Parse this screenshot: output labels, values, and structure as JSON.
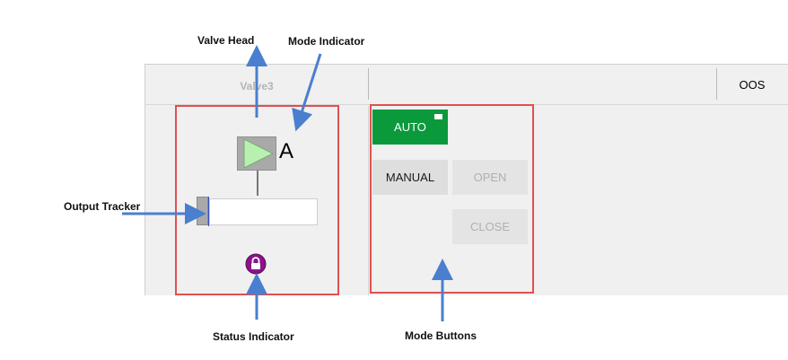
{
  "panel": {
    "title": "Valve3",
    "oos_label": "OOS"
  },
  "valve": {
    "mode_letter": "A"
  },
  "buttons": {
    "auto": "AUTO",
    "manual": "MANUAL",
    "open": "OPEN",
    "close": "CLOSE"
  },
  "annotations": {
    "valve_head": "Valve Head",
    "mode_indicator": "Mode Indicator",
    "output_tracker": "Output Tracker",
    "status_indicator": "Status Indicator",
    "mode_buttons": "Mode Buttons"
  },
  "colors": {
    "auto_green": "#0a9a3c",
    "highlight_red": "#e05050",
    "arrow_blue": "#4a7fd0",
    "lock_purple": "#8a148a"
  }
}
